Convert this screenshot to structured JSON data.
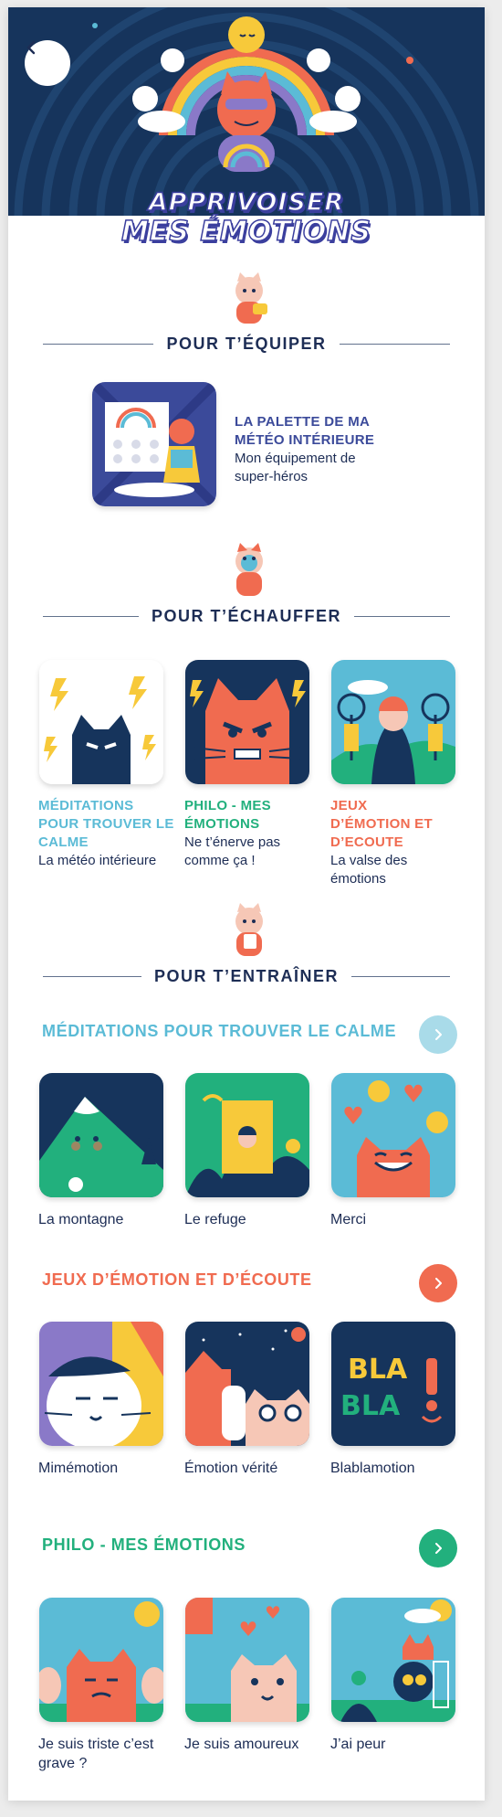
{
  "hero": {
    "title_line1": "APPRIVOISER",
    "title_line2": "MES ÉMOTIONS",
    "back_icon": "chevron-left-icon"
  },
  "sections": {
    "equip": "POUR T’ÉQUIPER",
    "warmup": "POUR T’ÉCHAUFFER",
    "train": "POUR T’ENTRAÎNER"
  },
  "equip_item": {
    "category": "LA PALETTE DE MA MÉTÉO INTÉRIEURE",
    "title": "Mon équipement de super-héros"
  },
  "warmup_items": [
    {
      "category": "MÉDITATIONS POUR TROUVER LE CALME",
      "title": "La météo intérieure"
    },
    {
      "category": "PHILO - MES ÉMOTIONS",
      "title": "Ne t’énerve pas comme ça !"
    },
    {
      "category": "JEUX D’ÉMOTION ET D’ECOUTE",
      "title": "La valse des émotions"
    }
  ],
  "rows": [
    {
      "title": "MÉDITATIONS POUR TROUVER LE CALME",
      "color": "#5bbbd6",
      "items": [
        "La montagne",
        "Le refuge",
        "Merci"
      ]
    },
    {
      "title": "JEUX D’ÉMOTION ET D’ÉCOUTE",
      "color": "#f06b50",
      "items": [
        "Mimémotion",
        "Émotion vérité",
        "Blablamotion"
      ]
    },
    {
      "title": "PHILO - MES ÉMOTIONS",
      "color": "#22b07d",
      "items": [
        "Je suis triste c’est grave ?",
        "Je suis amoureux",
        "J’ai peur"
      ]
    }
  ],
  "tile_text": {
    "bla1": "BLA",
    "bla2": "BLA"
  },
  "colors": {
    "navy": "#16345c",
    "blue": "#5bbbd6",
    "orange": "#f06b50",
    "green": "#22b07d",
    "text": "#1d2d55"
  }
}
